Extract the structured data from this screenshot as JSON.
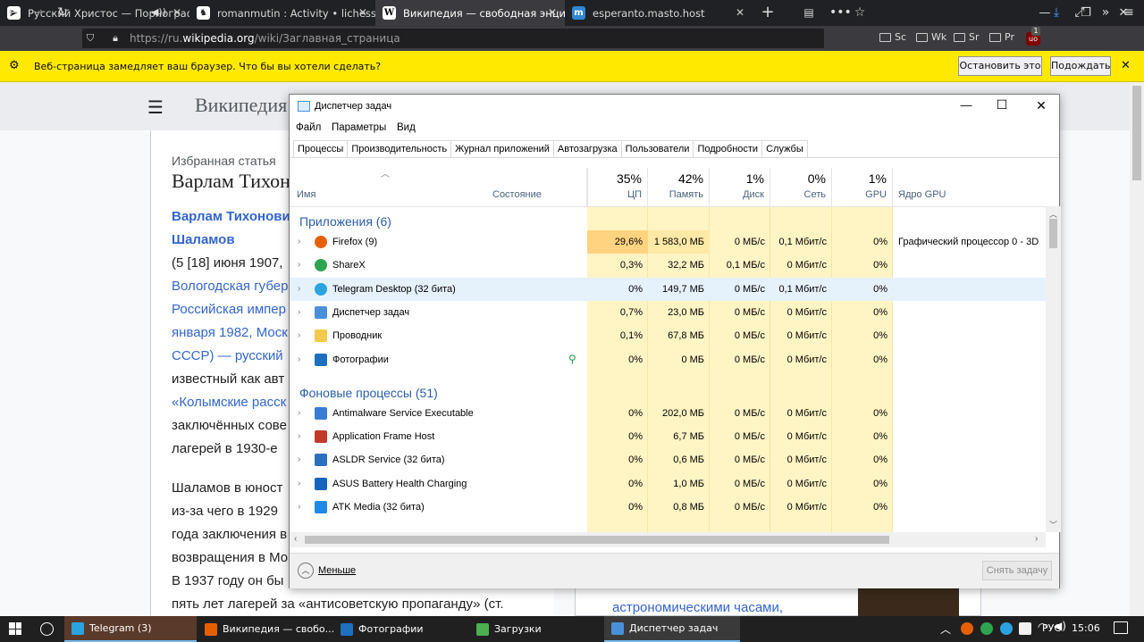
{
  "browser": {
    "tabs": [
      {
        "title": "Русский Христос — Порнограф",
        "favicon": "play-icon"
      },
      {
        "title": "romanmutin : Activity • lichess.org",
        "favicon": "lichess-icon"
      },
      {
        "title": "Википедия — свободная энциклопедия",
        "favicon": "wikipedia-icon"
      },
      {
        "title": "esperanto.masto.host",
        "favicon": "mastodon-icon"
      }
    ],
    "url_prefix": "https://ru.",
    "url_domain": "wikipedia.org",
    "url_path": "/wiki/Заглавная_страница",
    "bookmarks": [
      "Sc",
      "Wk",
      "Sr",
      "Pr"
    ],
    "ublock_badge": "1",
    "warning": {
      "text": "Веб-страница замедляет ваш браузер. Что бы вы хотели сделать?",
      "stop_label": "Остановить это",
      "wait_label": "Подождать"
    }
  },
  "wiki": {
    "logo_text": "Википедия",
    "featured_label": "Избранная статья",
    "title": "Варлам Тихонов",
    "lines": [
      {
        "t": "Варлам Тихонович",
        "c": "bold-link"
      },
      {
        "t": "Шаламов",
        "c": "bold-link"
      },
      {
        "t": "(5 [18] июня 1907,",
        "c": "mixed"
      },
      {
        "t": "Вологодская губер",
        "c": "link"
      },
      {
        "t": "Российская импер",
        "c": "link"
      },
      {
        "t": "января 1982, Моск",
        "c": "mixed2"
      },
      {
        "t": "СССР) — русский",
        "c": "mixed3"
      },
      {
        "t": "известный как авт",
        "c": "text"
      },
      {
        "t": "«Колымские расск",
        "c": "mixed4"
      },
      {
        "t": "заключённых сове",
        "c": "mixed5"
      },
      {
        "t": "лагерей в 1930-е",
        "c": "mixed6"
      }
    ],
    "para2": [
      "Шаламов в юност",
      "из-за чего в 1929",
      "года заключения в",
      "возвращения в Мо",
      "В 1937 году он бы",
      "пять лет лагерей за «антисоветскую пропаганду» (ст."
    ],
    "right_snippet": [
      "астрономическими часами,"
    ]
  },
  "taskmgr": {
    "title": "Диспетчер задач",
    "menu": [
      "Файл",
      "Параметры",
      "Вид"
    ],
    "tabs": [
      "Процессы",
      "Производительность",
      "Журнал приложений",
      "Автозагрузка",
      "Пользователи",
      "Подробности",
      "Службы"
    ],
    "columns": {
      "name": "Имя",
      "status": "Состояние",
      "cpu": {
        "pct": "35%",
        "label": "ЦП"
      },
      "mem": {
        "pct": "42%",
        "label": "Память"
      },
      "disk": {
        "pct": "1%",
        "label": "Диск"
      },
      "net": {
        "pct": "0%",
        "label": "Сеть"
      },
      "gpu": {
        "pct": "1%",
        "label": "GPU"
      },
      "gpu_engine": "Ядро GPU"
    },
    "groups": {
      "apps": "Приложения (6)",
      "background": "Фоновые процессы (51)"
    },
    "apps": [
      {
        "name": "Firefox (9)",
        "cpu": "29,6%",
        "mem": "1 583,0 МБ",
        "disk": "0 МБ/с",
        "net": "0,1 Мбит/с",
        "gpu": "0%",
        "engine": "Графический процессор 0 - 3D",
        "icon": "firefox-icon",
        "color": "#e66000"
      },
      {
        "name": "ShareX",
        "cpu": "0,3%",
        "mem": "32,2 МБ",
        "disk": "0,1 МБ/с",
        "net": "0 Мбит/с",
        "gpu": "0%",
        "engine": "",
        "icon": "sharex-icon",
        "color": "#2ea44f"
      },
      {
        "name": "Telegram Desktop (32 бита)",
        "cpu": "0%",
        "mem": "149,7 МБ",
        "disk": "0 МБ/с",
        "net": "0,1 Мбит/с",
        "gpu": "0%",
        "engine": "",
        "icon": "telegram-icon",
        "color": "#2aa3df"
      },
      {
        "name": "Диспетчер задач",
        "cpu": "0,7%",
        "mem": "23,0 МБ",
        "disk": "0 МБ/с",
        "net": "0 Мбит/с",
        "gpu": "0%",
        "engine": "",
        "icon": "taskmgr-icon",
        "color": "#4a90d9"
      },
      {
        "name": "Проводник",
        "cpu": "0,1%",
        "mem": "67,8 МБ",
        "disk": "0 МБ/с",
        "net": "0 Мбит/с",
        "gpu": "0%",
        "engine": "",
        "icon": "explorer-icon",
        "color": "#f2c94c"
      },
      {
        "name": "Фотографии",
        "cpu": "0%",
        "mem": "0 МБ",
        "disk": "0 МБ/с",
        "net": "0 Мбит/с",
        "gpu": "0%",
        "engine": "",
        "icon": "photos-icon",
        "color": "#1f6fbf"
      }
    ],
    "background": [
      {
        "name": "Antimalware Service Executable",
        "cpu": "0%",
        "mem": "202,0 МБ",
        "disk": "0 МБ/с",
        "net": "0 Мбит/с",
        "gpu": "0%",
        "icon": "defender-icon",
        "color": "#3a7bd5"
      },
      {
        "name": "Application Frame Host",
        "cpu": "0%",
        "mem": "6,7 МБ",
        "disk": "0 МБ/с",
        "net": "0 Мбит/с",
        "gpu": "0%",
        "icon": "appframe-icon",
        "color": "#c0392b"
      },
      {
        "name": "ASLDR Service (32 бита)",
        "cpu": "0%",
        "mem": "0,6 МБ",
        "disk": "0 МБ/с",
        "net": "0 Мбит/с",
        "gpu": "0%",
        "icon": "asldr-icon",
        "color": "#2c6fbd"
      },
      {
        "name": "ASUS Battery Health Charging",
        "cpu": "0%",
        "mem": "1,0 МБ",
        "disk": "0 МБ/с",
        "net": "0 Мбит/с",
        "gpu": "0%",
        "icon": "asus-battery-icon",
        "color": "#1565c0"
      },
      {
        "name": "ATK Media (32 бита)",
        "cpu": "0%",
        "mem": "0,8 МБ",
        "disk": "0 МБ/с",
        "net": "0 Мбит/с",
        "gpu": "0%",
        "icon": "atk-media-icon",
        "color": "#1e88e5"
      }
    ],
    "fewer_label": "Меньше",
    "end_task_label": "Снять задачу"
  },
  "taskbar": {
    "items": [
      {
        "label": "Telegram (3)",
        "icon": "telegram-icon",
        "color": "#2aa3df",
        "active": true
      },
      {
        "label": "Википедия — свобо...",
        "icon": "firefox-icon",
        "color": "#e66000",
        "active": false
      },
      {
        "label": "Фотографии",
        "icon": "photos-icon",
        "color": "#1f6fbf",
        "active": false
      },
      {
        "label": "Загрузки",
        "icon": "downloads-icon",
        "color": "#4caf50",
        "active": false
      },
      {
        "label": "Диспетчер задач",
        "icon": "taskmgr-icon",
        "color": "#4a90d9",
        "active": true
      }
    ],
    "lang": "РУС",
    "time": "15:06"
  }
}
